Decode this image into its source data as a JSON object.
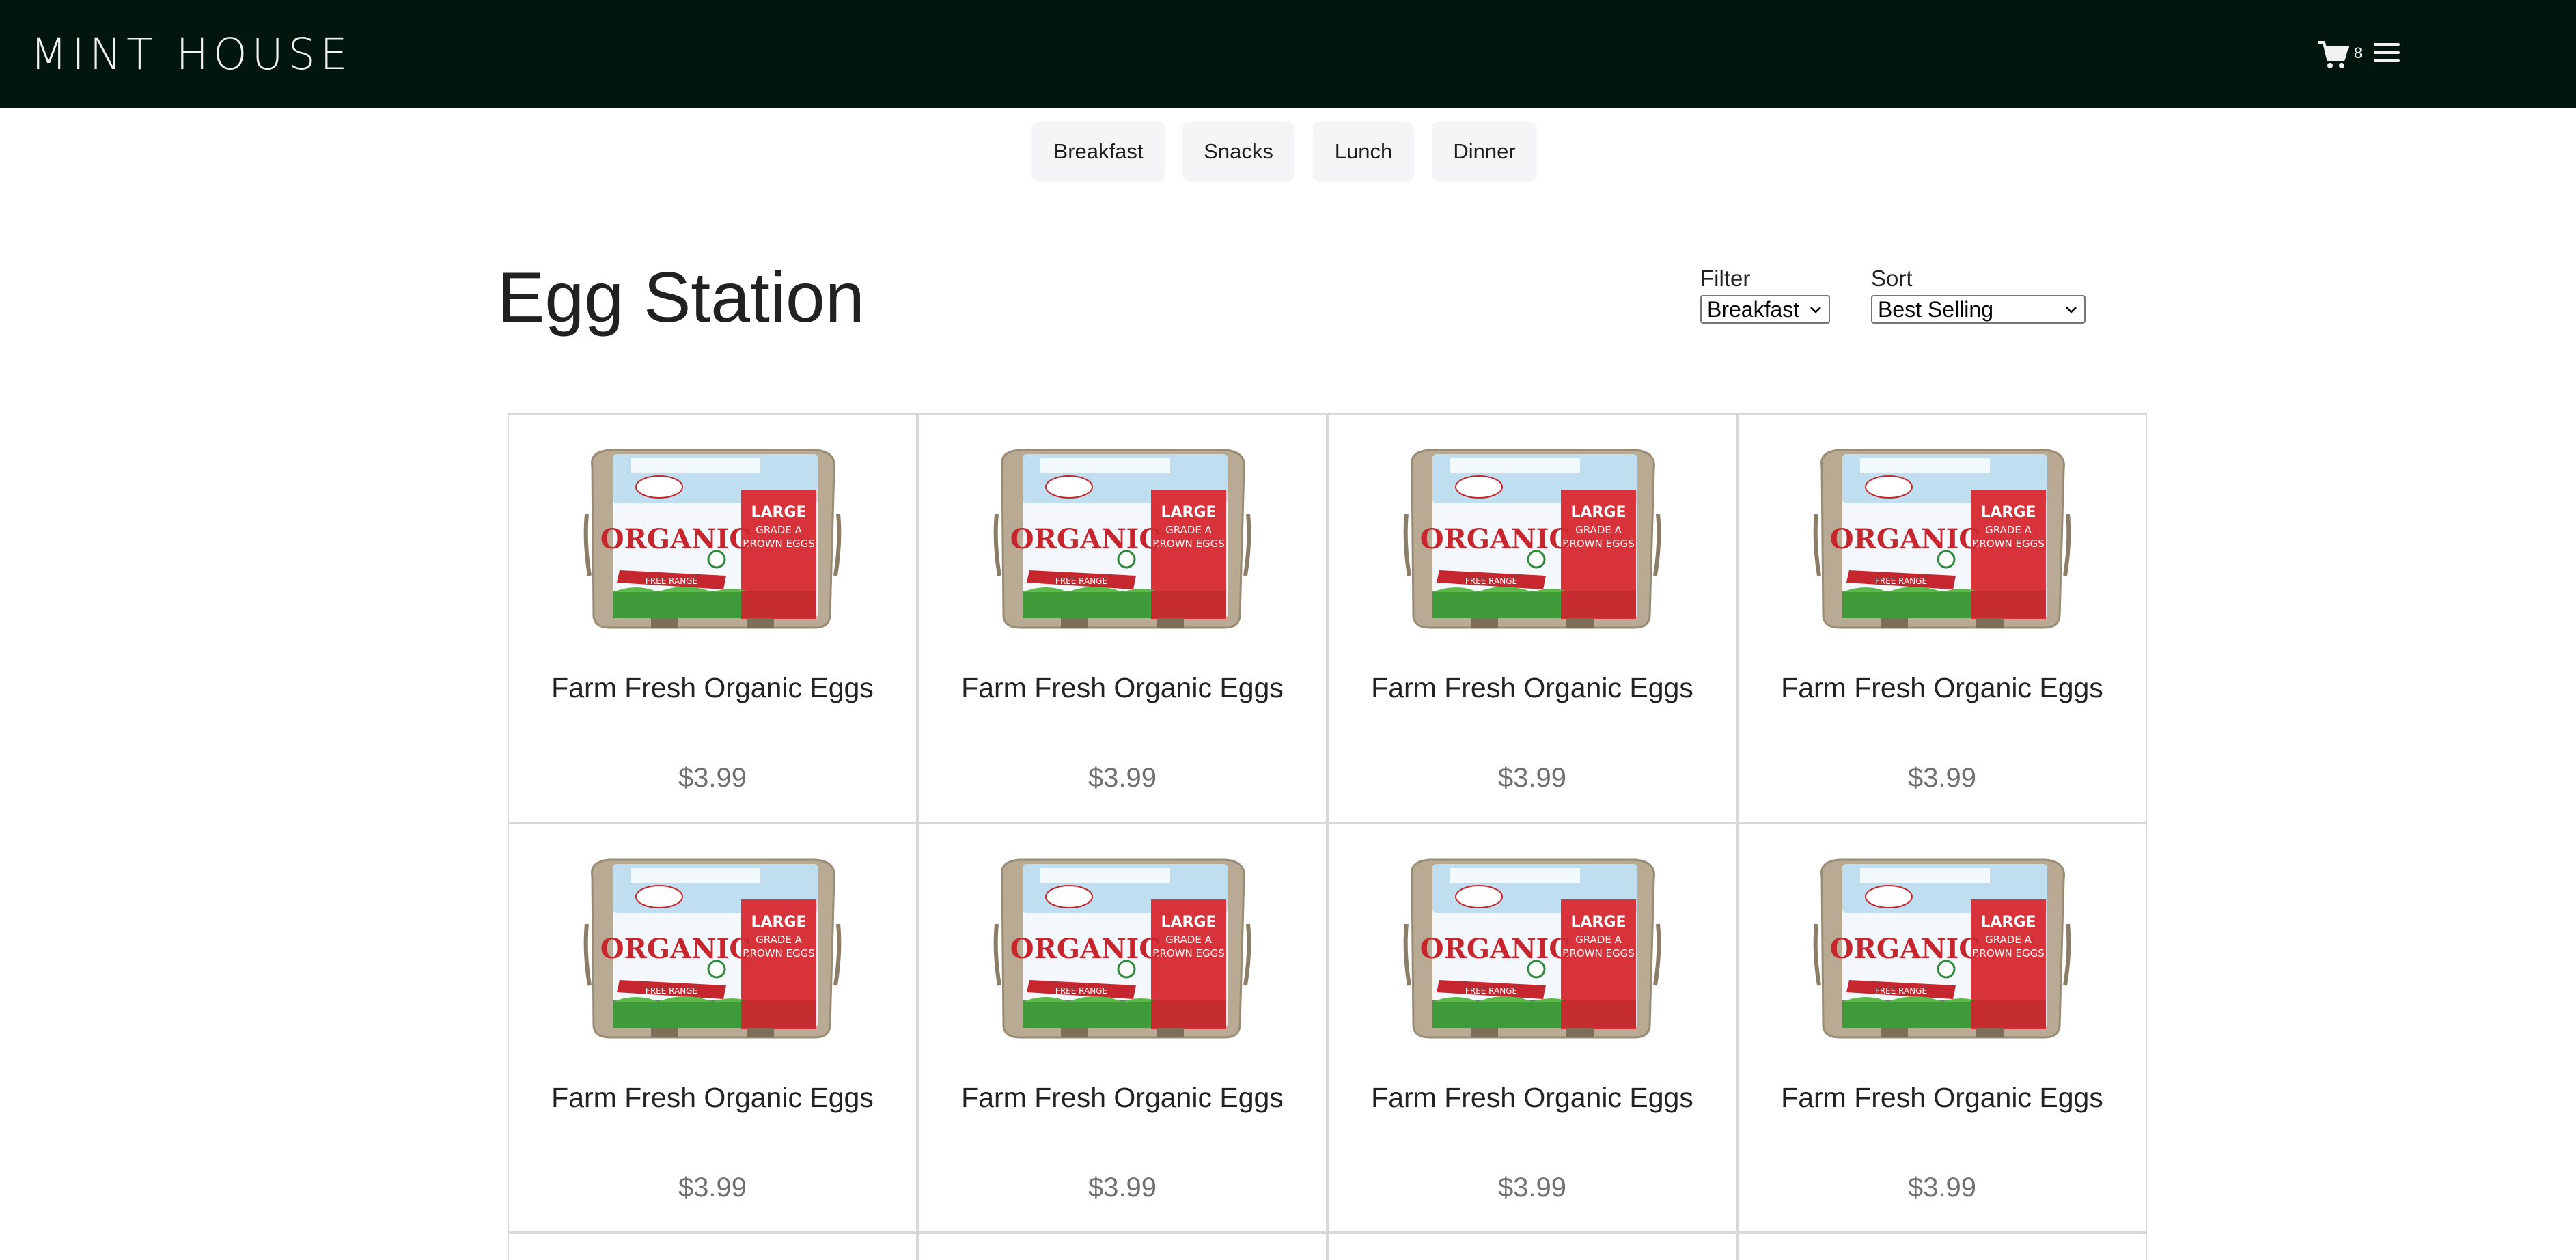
{
  "header": {
    "brand": "MINT HOUSE",
    "cart_count": "8",
    "colors": {
      "background": "#02160e",
      "text": "#f2f2f2"
    }
  },
  "categories": [
    {
      "label": "Breakfast"
    },
    {
      "label": "Snacks"
    },
    {
      "label": "Lunch"
    },
    {
      "label": "Dinner"
    }
  ],
  "page": {
    "title": "Egg Station"
  },
  "filter": {
    "label": "Filter",
    "selected": "Breakfast"
  },
  "sort": {
    "label": "Sort",
    "selected": "Best Selling"
  },
  "products": [
    {
      "name": "Farm Fresh Organic Eggs",
      "price": "$3.99"
    },
    {
      "name": "Farm Fresh Organic Eggs",
      "price": "$3.99"
    },
    {
      "name": "Farm Fresh Organic Eggs",
      "price": "$3.99"
    },
    {
      "name": "Farm Fresh Organic Eggs",
      "price": "$3.99"
    },
    {
      "name": "Farm Fresh Organic Eggs",
      "price": "$3.99"
    },
    {
      "name": "Farm Fresh Organic Eggs",
      "price": "$3.99"
    },
    {
      "name": "Farm Fresh Organic Eggs",
      "price": "$3.99"
    },
    {
      "name": "Farm Fresh Organic Eggs",
      "price": "$3.99"
    }
  ],
  "product_image": {
    "icon": "egg-carton-image",
    "texts": [
      "ORGANIC",
      "LARGE",
      "GRADE A",
      "BROWN EGGS",
      "FREE RANGE"
    ]
  }
}
